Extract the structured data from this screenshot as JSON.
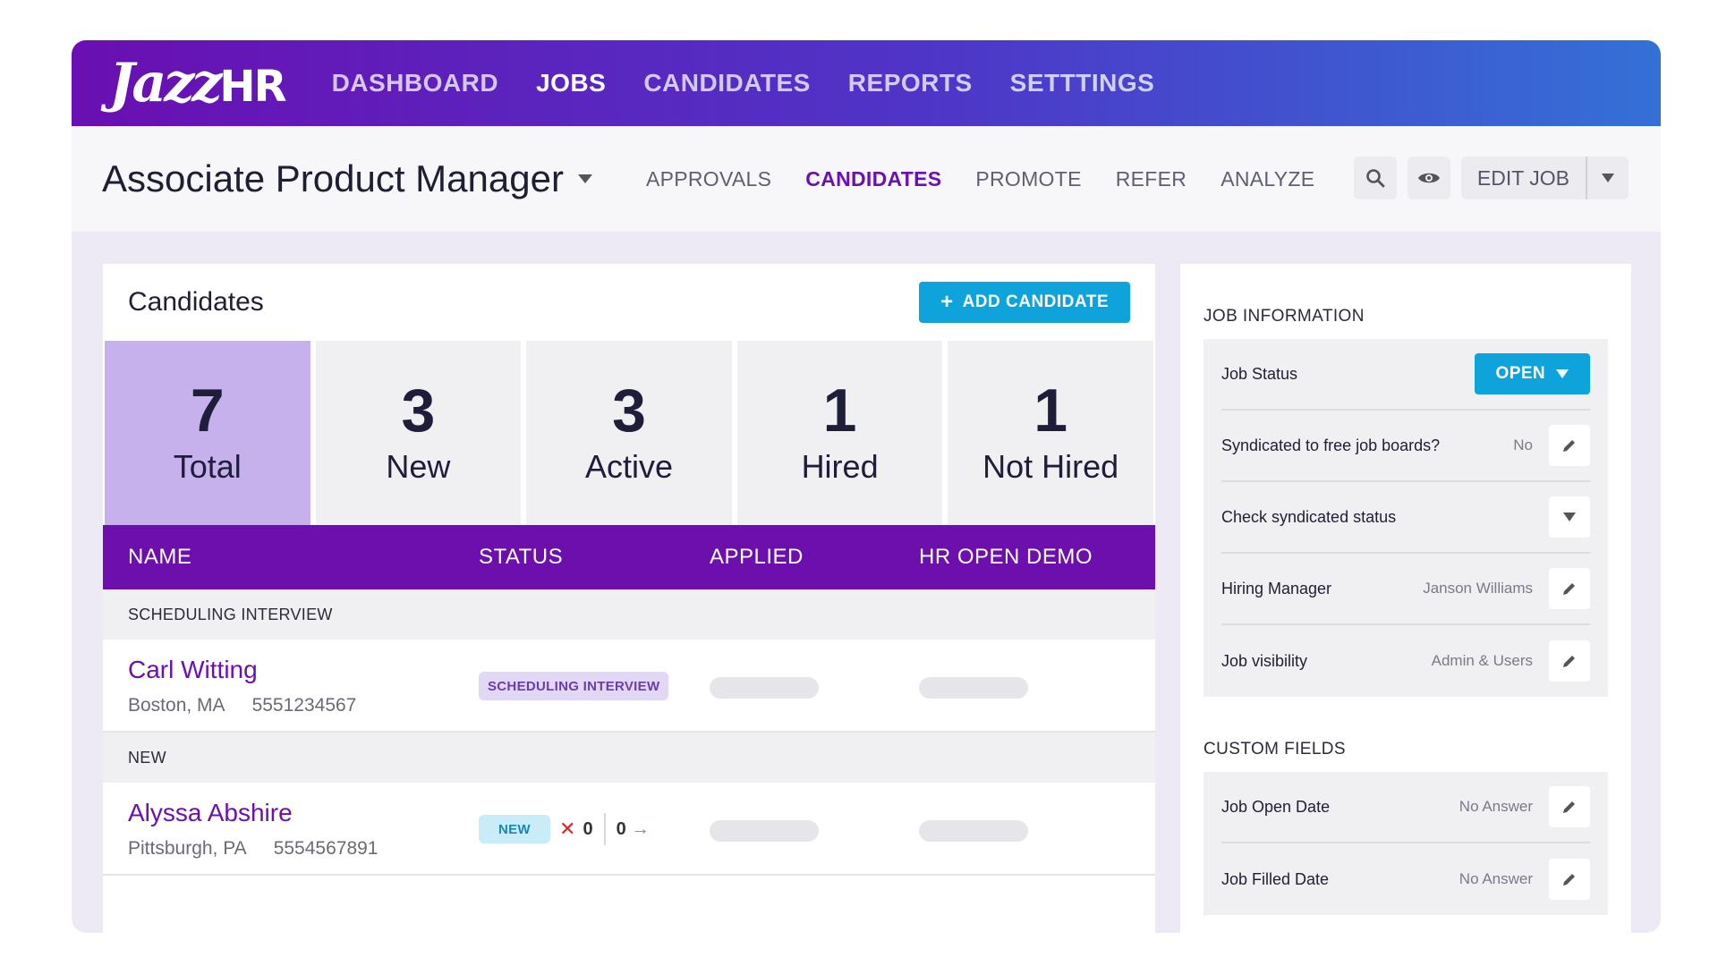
{
  "brand": {
    "logo_jazz": "Jazz",
    "logo_hr": "HR"
  },
  "topnav": [
    {
      "label": "DASHBOARD",
      "active": false
    },
    {
      "label": "JOBS",
      "active": true
    },
    {
      "label": "CANDIDATES",
      "active": false
    },
    {
      "label": "REPORTS",
      "active": false
    },
    {
      "label": "SETTTINGS",
      "active": false
    }
  ],
  "job": {
    "title": "Associate Product Manager",
    "tabs": [
      {
        "label": "APPROVALS",
        "active": false
      },
      {
        "label": "CANDIDATES",
        "active": true
      },
      {
        "label": "PROMOTE",
        "active": false
      },
      {
        "label": "REFER",
        "active": false
      },
      {
        "label": "ANALYZE",
        "active": false
      }
    ],
    "edit_label": "EDIT JOB"
  },
  "candidates": {
    "title": "Candidates",
    "add_label": "ADD CANDIDATE",
    "stats": [
      {
        "count": "7",
        "label": "Total",
        "active": true
      },
      {
        "count": "3",
        "label": "New",
        "active": false
      },
      {
        "count": "3",
        "label": "Active",
        "active": false
      },
      {
        "count": "1",
        "label": "Hired",
        "active": false
      },
      {
        "count": "1",
        "label": "Not Hired",
        "active": false
      }
    ],
    "columns": [
      "NAME",
      "STATUS",
      "APPLIED",
      "HR OPEN DEMO"
    ],
    "groups": [
      {
        "label": "SCHEDULING INTERVIEW",
        "rows": [
          {
            "name": "Carl Witting",
            "location": "Boston, MA",
            "phone": "5551234567",
            "status": "SCHEDULING INTERVIEW"
          }
        ]
      },
      {
        "label": "NEW",
        "rows": [
          {
            "name": "Alyssa Abshire",
            "location": "Pittsburgh, PA",
            "phone": "5554567891",
            "status": "NEW",
            "votes_down": "0",
            "votes_up": "0"
          }
        ]
      }
    ]
  },
  "job_info": {
    "title": "JOB INFORMATION",
    "status_label": "Job Status",
    "status_value": "OPEN",
    "rows": [
      {
        "label": "Syndicated to free job boards?",
        "value": "No"
      },
      {
        "label": "Check syndicated status",
        "value": ""
      },
      {
        "label": "Hiring Manager",
        "value": "Janson Williams"
      },
      {
        "label": "Job visibility",
        "value": "Admin & Users"
      }
    ]
  },
  "custom_fields": {
    "title": "CUSTOM FIELDS",
    "rows": [
      {
        "label": "Job Open Date",
        "value": "No Answer"
      },
      {
        "label": "Job Filled Date",
        "value": "No Answer"
      }
    ]
  }
}
